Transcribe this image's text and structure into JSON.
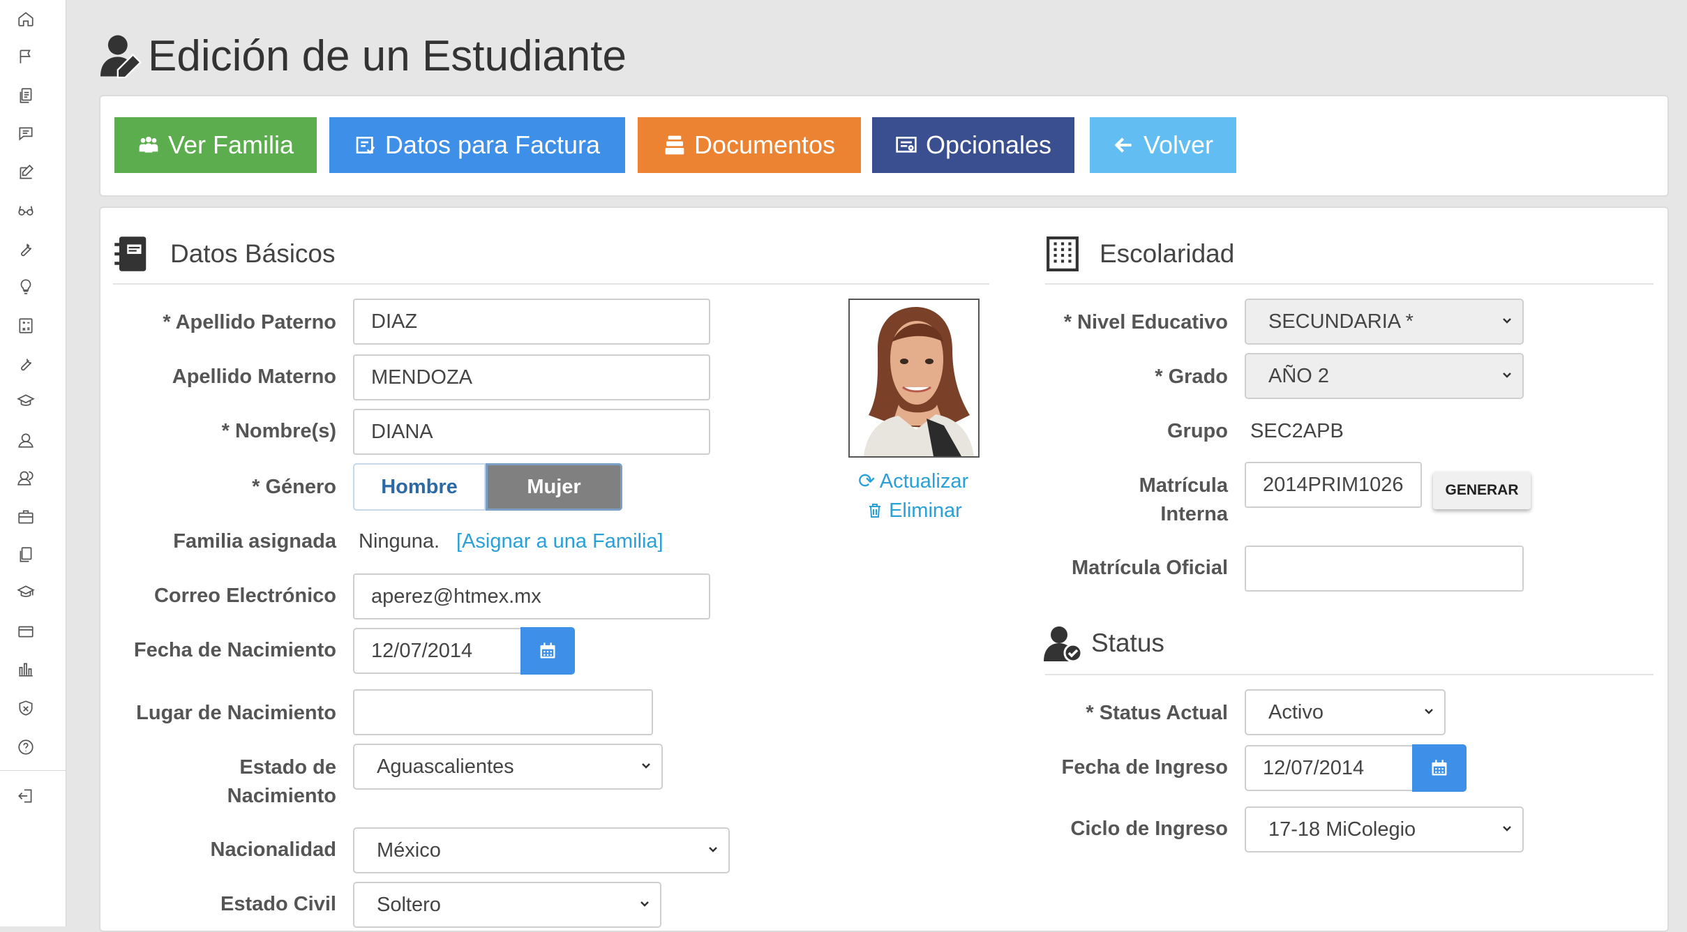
{
  "sidebar": {
    "items": [
      {
        "icon": "home-icon"
      },
      {
        "icon": "flag-icon"
      },
      {
        "icon": "documents-icon"
      },
      {
        "icon": "chat-icon"
      },
      {
        "icon": "edit-icon"
      },
      {
        "icon": "glasses-icon"
      },
      {
        "icon": "wrench-icon"
      },
      {
        "icon": "lightbulb-icon"
      },
      {
        "icon": "calculator-icon"
      },
      {
        "icon": "tools-icon"
      },
      {
        "icon": "graduation-cap-icon"
      },
      {
        "icon": "user-headset-icon"
      },
      {
        "icon": "users-icon"
      },
      {
        "icon": "briefcase-icon"
      },
      {
        "icon": "files-icon"
      },
      {
        "icon": "mortarboard-icon"
      },
      {
        "icon": "credit-card-icon"
      },
      {
        "icon": "bar-chart-icon"
      },
      {
        "icon": "shield-icon"
      },
      {
        "icon": "help-icon"
      },
      {
        "icon": "logout-icon"
      }
    ]
  },
  "page": {
    "title": "Edición de un Estudiante"
  },
  "toolbar": {
    "buttons": [
      {
        "label": "Ver Familia",
        "icon": "family-icon",
        "color": "#5bad4e"
      },
      {
        "label": "Datos para Factura",
        "icon": "invoice-icon",
        "color": "#3d8fe8"
      },
      {
        "label": "Documentos",
        "icon": "documents-stack-icon",
        "color": "#ec8332"
      },
      {
        "label": "Opcionales",
        "icon": "certificate-icon",
        "color": "#3a4f8f"
      },
      {
        "label": "Volver",
        "icon": "arrow-left-icon",
        "color": "#62bdf2"
      }
    ]
  },
  "datos_basicos": {
    "heading": "Datos Básicos",
    "apellido_paterno": {
      "label": "* Apellido Paterno",
      "value": "DIAZ"
    },
    "apellido_materno": {
      "label": "Apellido Materno",
      "value": "MENDOZA"
    },
    "nombres": {
      "label": "* Nombre(s)",
      "value": "DIANA"
    },
    "genero": {
      "label": "* Género",
      "option_a": "Hombre",
      "option_b": "Mujer",
      "selected": "Mujer"
    },
    "familia": {
      "label": "Familia asignada",
      "value": "Ninguna.",
      "link": "[Asignar a una Familia]"
    },
    "correo": {
      "label": "Correo Electrónico",
      "value": "aperez@htmex.mx"
    },
    "fecha_nacimiento": {
      "label": "Fecha de Nacimiento",
      "value": "12/07/2014"
    },
    "lugar_nacimiento": {
      "label": "Lugar de Nacimiento",
      "value": ""
    },
    "estado_nacimiento": {
      "label_1": "Estado de",
      "label_2": "Nacimiento",
      "value": "Aguascalientes"
    },
    "nacionalidad": {
      "label": "Nacionalidad",
      "value": "México"
    },
    "estado_civil": {
      "label": "Estado Civil",
      "value": "Soltero"
    },
    "photo": {
      "actualizar": "Actualizar",
      "eliminar": "Eliminar"
    }
  },
  "escolaridad": {
    "heading": "Escolaridad",
    "nivel": {
      "label": "* Nivel Educativo",
      "value": "SECUNDARIA *"
    },
    "grado": {
      "label": "* Grado",
      "value": "AÑO 2"
    },
    "grupo": {
      "label": "Grupo",
      "value": "SEC2APB"
    },
    "matricula_interna": {
      "label_1": "Matrícula",
      "label_2": "Interna",
      "value": "2014PRIM1026",
      "button": "GENERAR"
    },
    "matricula_oficial": {
      "label": "Matrícula Oficial",
      "value": ""
    }
  },
  "status": {
    "heading": "Status",
    "actual": {
      "label": "* Status Actual",
      "value": "Activo"
    },
    "fecha_ingreso": {
      "label": "Fecha de Ingreso",
      "value": "12/07/2014"
    },
    "ciclo": {
      "label": "Ciclo de Ingreso",
      "value": "17-18 MiColegio"
    }
  }
}
